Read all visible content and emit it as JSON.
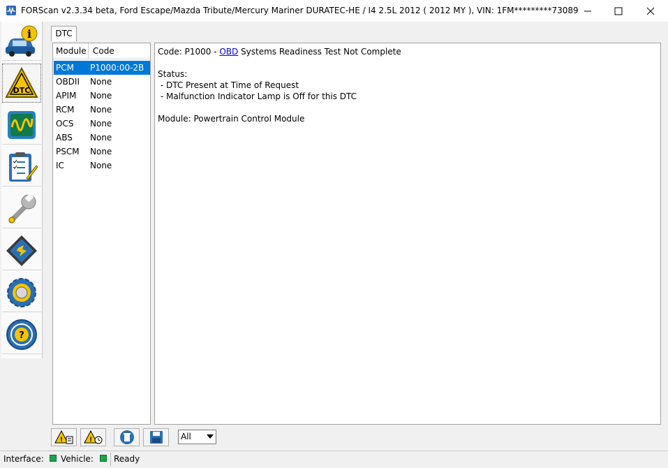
{
  "window": {
    "title": "FORScan v2.3.34 beta, Ford Escape/Mazda Tribute/Mercury Mariner DURATEC-HE / I4 2.5L 2012 ( 2012 MY ), VIN: 1FM*********73089",
    "min_glyph": "—",
    "max_glyph": "☐",
    "close_glyph": "✕"
  },
  "sidebar": {
    "items": [
      {
        "name": "vehicle-info",
        "active": false
      },
      {
        "name": "dtc",
        "label": "DTC",
        "active": true
      },
      {
        "name": "oscilloscope",
        "active": false
      },
      {
        "name": "checklist",
        "active": false
      },
      {
        "name": "service",
        "active": false
      },
      {
        "name": "configuration",
        "active": false
      },
      {
        "name": "settings",
        "active": false
      },
      {
        "name": "help",
        "active": false
      }
    ]
  },
  "tab": {
    "label": "DTC"
  },
  "module_table": {
    "headers": {
      "module": "Module",
      "code": "Code"
    },
    "rows": [
      {
        "module": "PCM",
        "code": "P1000:00-2B",
        "selected": true
      },
      {
        "module": "OBDII",
        "code": "None"
      },
      {
        "module": "APIM",
        "code": "None"
      },
      {
        "module": "RCM",
        "code": "None"
      },
      {
        "module": "OCS",
        "code": "None"
      },
      {
        "module": "ABS",
        "code": "None"
      },
      {
        "module": "PSCM",
        "code": "None"
      },
      {
        "module": "IC",
        "code": "None"
      }
    ]
  },
  "detail": {
    "code_prefix": "Code: P1000 - ",
    "code_link": "OBD",
    "code_suffix": " Systems Readiness Test Not Complete",
    "status_label": "Status:",
    "status_lines": [
      " - DTC Present at Time of Request",
      " - Malfunction Indicator Lamp is Off for this DTC"
    ],
    "module_line": "Module: Powertrain Control Module"
  },
  "toolbar": {
    "filter_value": "All"
  },
  "statusbar": {
    "interface_label": "Interface:",
    "vehicle_label": "Vehicle:",
    "status_text": "Ready"
  },
  "colors": {
    "selection": "#0078d7",
    "led_green": "#1ea34a",
    "link": "#0000ee"
  }
}
